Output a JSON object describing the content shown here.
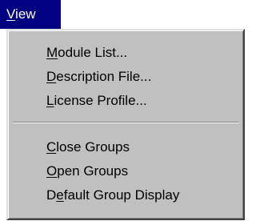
{
  "menu_bar": {
    "title": {
      "mnemonic": "V",
      "rest": "iew"
    }
  },
  "menu": {
    "items": [
      {
        "pre": "",
        "mnemonic": "M",
        "post": "odule List..."
      },
      {
        "pre": "",
        "mnemonic": "D",
        "post": "escription File..."
      },
      {
        "pre": "",
        "mnemonic": "L",
        "post": "icense Profile..."
      },
      {
        "pre": "",
        "mnemonic": "C",
        "post": "lose Groups"
      },
      {
        "pre": "",
        "mnemonic": "O",
        "post": "pen Groups"
      },
      {
        "pre": "D",
        "mnemonic": "e",
        "post": "fault Group Display"
      }
    ]
  }
}
